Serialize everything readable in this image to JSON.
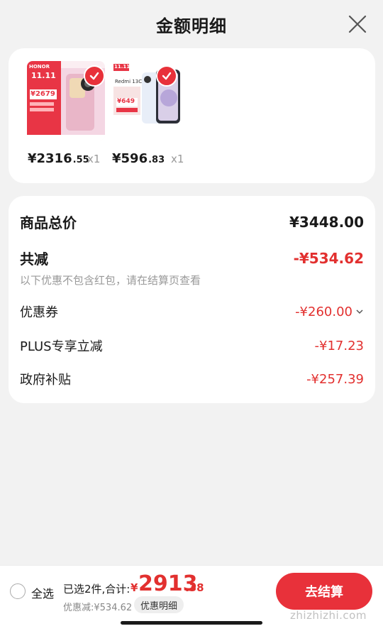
{
  "header": {
    "title": "金额明细"
  },
  "products": [
    {
      "price_int": "¥2316",
      "price_dec": ".55",
      "qty": "x1",
      "thumb_text": "11.11",
      "thumb_price": "¥2679",
      "brand": "HONOR"
    },
    {
      "price_int": "¥596",
      "price_dec": ".83",
      "qty": "x1",
      "thumb_text": "11.11",
      "thumb_price": "¥649",
      "brand": "Redmi 13C"
    }
  ],
  "summary": {
    "total_label": "商品总价",
    "total_value": "¥3448.00",
    "reduce_label": "共减",
    "reduce_value": "-¥534.62",
    "note": "以下优惠不包含红包，请在结算页查看",
    "items": [
      {
        "label": "优惠券",
        "value": "-¥260.00"
      },
      {
        "label": "PLUS专享立减",
        "value": "-¥17.23"
      },
      {
        "label": "政府补贴",
        "value": "-¥257.39"
      }
    ]
  },
  "bottom": {
    "select_all": "全选",
    "selected_info": "已选2件,合计:",
    "total_yuan": "¥",
    "total_int": "2913",
    "total_dec": ".38",
    "saved": "优惠减:¥534.62",
    "detail_tag": "优惠明细",
    "checkout": "去结算"
  },
  "watermark": {
    "text": "zhizhizhi.com"
  },
  "colors": {
    "accent": "#e8313a",
    "discount": "#e2302f",
    "background": "#f2f2f2"
  }
}
